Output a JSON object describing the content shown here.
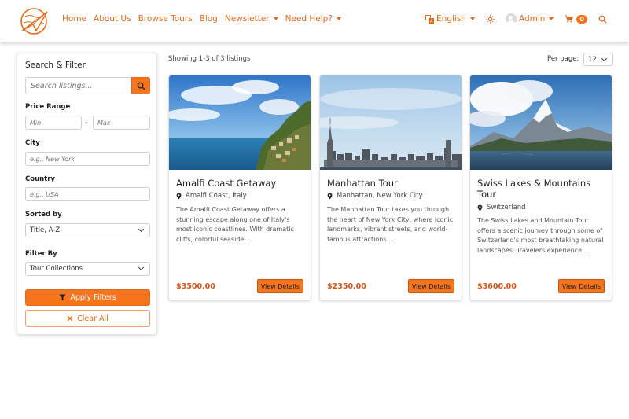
{
  "nav": {
    "links": [
      {
        "label": "Home",
        "dropdown": false
      },
      {
        "label": "About Us",
        "dropdown": false
      },
      {
        "label": "Browse Tours",
        "dropdown": false
      },
      {
        "label": "Blog",
        "dropdown": false
      },
      {
        "label": "Newsletter",
        "dropdown": true
      },
      {
        "label": "Need Help?",
        "dropdown": true
      }
    ],
    "language": "English",
    "user": "Admin",
    "cart_count": "0",
    "accent": "#e06a1b"
  },
  "sidebar": {
    "title": "Search & Filter",
    "search_placeholder": "Search listings...",
    "price_label": "Price Range",
    "min_placeholder": "Min",
    "max_placeholder": "Max",
    "dash": "-",
    "city_label": "City",
    "city_placeholder": "e.g., New York",
    "country_label": "Country",
    "country_placeholder": "e.g., USA",
    "sort_label": "Sorted by",
    "sort_value": "Title, A-Z",
    "filter_label": "Filter By",
    "filter_value": "Tour Collections",
    "apply_label": "Apply Filters",
    "clear_label": "Clear All"
  },
  "listings": {
    "showing": "Showing 1-3 of 3 listings",
    "per_page_label": "Per page:",
    "per_page_value": "12",
    "cards": [
      {
        "title": "Amalfi Coast Getaway",
        "location": "Amalfi Coast, Italy",
        "description": "The Amalfi Coast Getaway offers a stunning escape along one of Italy's most iconic coastlines. With dramatic cliffs, colorful seaside ...",
        "price": "$3500.00",
        "button": "View Details"
      },
      {
        "title": "Manhattan Tour",
        "location": "Manhattan, New York City",
        "description": "The Manhattan Tour takes you through the heart of New York City, where iconic landmarks, vibrant streets, and world-famous attractions ...",
        "price": "$2350.00",
        "button": "View Details"
      },
      {
        "title": "Swiss Lakes & Mountains Tour",
        "location": "Switzerland",
        "description": "The Swiss Lakes and Mountain Tour offers a scenic journey through some of Switzerland's most breathtaking natural landscapes. Travelers experience ...",
        "price": "$3600.00",
        "button": "View Details"
      }
    ]
  }
}
